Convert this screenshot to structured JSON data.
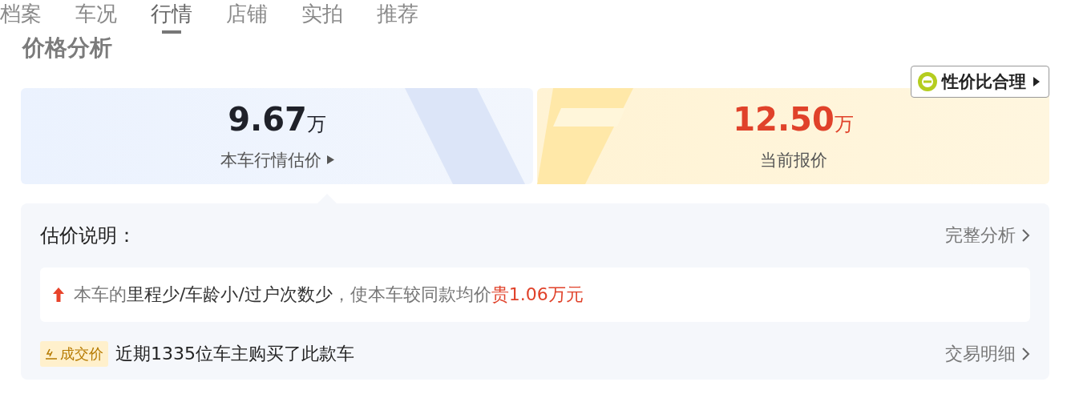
{
  "tabs": [
    {
      "label": "档案",
      "selected": false
    },
    {
      "label": "车况",
      "selected": false
    },
    {
      "label": "行情",
      "selected": true
    },
    {
      "label": "店铺",
      "selected": false
    },
    {
      "label": "实拍",
      "selected": false
    },
    {
      "label": "推荐",
      "selected": false
    }
  ],
  "section_title": "价格分析",
  "value_badge": {
    "label": "性价比合理"
  },
  "price_cards": [
    {
      "kind": "estimate",
      "amount": "9.67",
      "unit": "万",
      "label": "本车行情估价",
      "selected": true
    },
    {
      "kind": "asking",
      "amount": "12.50",
      "unit": "万",
      "label": "当前报价",
      "selected": false
    }
  ],
  "explanation": {
    "title": "估价说明：",
    "link": "完整分析",
    "note": {
      "kind": "rise",
      "segments": [
        {
          "kind": "muted",
          "text": "本车的"
        },
        {
          "kind": "strong",
          "text": "里程少/车龄小/过户次数少"
        },
        {
          "kind": "muted",
          "text": "，使本车较同款均价"
        },
        {
          "kind": "alert",
          "text": "贵1.06万元"
        }
      ]
    },
    "deal": {
      "tag": "成交价",
      "text": "近期1335位车主购买了此款车",
      "link": "交易明细"
    }
  }
}
